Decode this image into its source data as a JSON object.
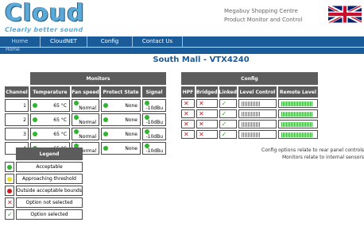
{
  "brand": {
    "logo_text": "Cloud",
    "tagline": "Clearly better sound"
  },
  "site": {
    "line1": "Megabuy Shopping Centre",
    "line2": "Product Monitor and Control"
  },
  "nav": {
    "tabs": [
      {
        "label": "Home"
      },
      {
        "label": "CloudNET"
      },
      {
        "label": "Config"
      },
      {
        "label": "Contact Us"
      }
    ],
    "active_tab": "Home"
  },
  "breadcrumb": "Home",
  "page_title": "South Mall - VTX4240",
  "monitors": {
    "group_label": "Monitors",
    "headers": [
      "Channel",
      "Temperature",
      "Fan speed",
      "Protect State",
      "Signal"
    ],
    "rows": [
      {
        "channel": "1",
        "temperature": "65 °C",
        "fan": "Normal",
        "protect": "None",
        "signal": "-10dBu",
        "status": "green"
      },
      {
        "channel": "2",
        "temperature": "65 °C",
        "fan": "Normal",
        "protect": "None",
        "signal": "-10dBu",
        "status": "green"
      },
      {
        "channel": "3",
        "temperature": "65 °C",
        "fan": "Normal",
        "protect": "None",
        "signal": "-10dBu",
        "status": "green"
      },
      {
        "channel": "4",
        "temperature": "65 °C",
        "fan": "Normal",
        "protect": "None",
        "signal": "-10dBu",
        "status": "green"
      }
    ]
  },
  "config": {
    "group_label": "Config",
    "headers": [
      "HPF",
      "Bridged",
      "Linked",
      "Level Control",
      "Remote Level"
    ],
    "rows": [
      {
        "hpf": "off",
        "bridged": "off",
        "linked": "on",
        "level_control": 0.6,
        "remote_level": 1.0
      },
      {
        "hpf": "off",
        "bridged": "off",
        "linked": "on",
        "level_control": 0.6,
        "remote_level": 1.0
      },
      {
        "hpf": "off",
        "bridged": "off",
        "linked": "on",
        "level_control": 0.6,
        "remote_level": 1.0
      },
      {
        "hpf": "off",
        "bridged": "off",
        "linked": "on",
        "level_control": 0.6,
        "remote_level": 1.0
      }
    ]
  },
  "legend": {
    "title": "Legend",
    "items": [
      {
        "icon": "green-dot",
        "label": "Acceptable"
      },
      {
        "icon": "yellow-dot",
        "label": "Approaching threshold"
      },
      {
        "icon": "red-dot",
        "label": "Outside acceptable bounds"
      },
      {
        "icon": "cross",
        "label": "Option not selected"
      },
      {
        "icon": "tick",
        "label": "Option selected"
      }
    ]
  },
  "notes": {
    "line1": "Config options relate to rear panel controls",
    "line2": "Monitors relate to internal sensors"
  },
  "colors": {
    "nav_blue": "#1a5c9a",
    "header_grey": "#5c5c5c",
    "ok_green": "#2fb52f",
    "warn_yellow": "#e5e526",
    "bad_red": "#d11b1b"
  }
}
